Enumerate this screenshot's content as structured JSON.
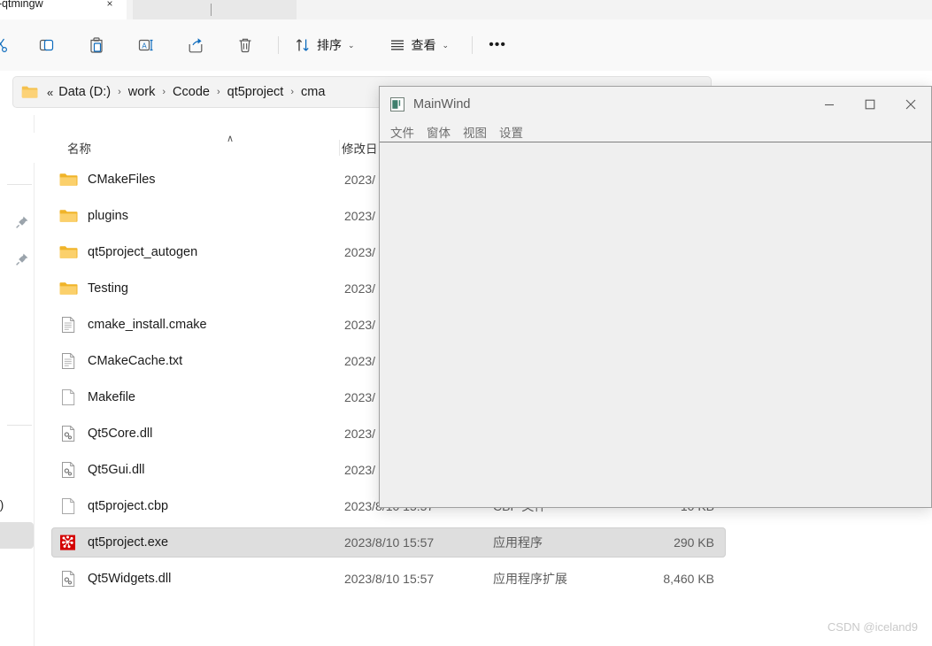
{
  "explorer": {
    "tab": {
      "title": "lease-qtmingw",
      "close_icon": "×",
      "close_icon_name": "close-icon"
    },
    "toolbar": {
      "buttons": [
        {
          "name": "cut-button",
          "icon": "cut-icon",
          "label": ""
        },
        {
          "name": "copy-button",
          "icon": "copy-icon",
          "label": ""
        },
        {
          "name": "paste-button",
          "icon": "paste-icon",
          "label": ""
        },
        {
          "name": "rename-button",
          "icon": "rename-icon",
          "label": ""
        },
        {
          "name": "share-button",
          "icon": "share-icon",
          "label": ""
        },
        {
          "name": "delete-button",
          "icon": "trash-icon",
          "label": ""
        }
      ],
      "sort_label": "排序",
      "view_label": "查看",
      "chevron": "⌄",
      "overflow_label": "•••"
    },
    "address": {
      "overflow_chevrons": "«",
      "separator": "›",
      "crumbs": [
        "Data (D:)",
        "work",
        "Ccode",
        "qt5project",
        "cma"
      ]
    },
    "nav": {
      "drive_label": ":)"
    },
    "columns": {
      "name": "名称",
      "date": "修改日",
      "sort_ascending_mark": "∧"
    },
    "files": [
      {
        "name": "CMakeFiles",
        "icon": "folder-icon",
        "date": "2023/",
        "type": "",
        "size": ""
      },
      {
        "name": "plugins",
        "icon": "folder-icon",
        "date": "2023/",
        "type": "",
        "size": ""
      },
      {
        "name": "qt5project_autogen",
        "icon": "folder-icon",
        "date": "2023/",
        "type": "",
        "size": ""
      },
      {
        "name": "Testing",
        "icon": "folder-icon",
        "date": "2023/",
        "type": "",
        "size": ""
      },
      {
        "name": "cmake_install.cmake",
        "icon": "text-file-icon",
        "date": "2023/",
        "type": "",
        "size": ""
      },
      {
        "name": "CMakeCache.txt",
        "icon": "text-file-icon",
        "date": "2023/",
        "type": "",
        "size": ""
      },
      {
        "name": "Makefile",
        "icon": "blank-file-icon",
        "date": "2023/",
        "type": "",
        "size": ""
      },
      {
        "name": "Qt5Core.dll",
        "icon": "dll-file-icon",
        "date": "2023/",
        "type": "",
        "size": ""
      },
      {
        "name": "Qt5Gui.dll",
        "icon": "dll-file-icon",
        "date": "2023/",
        "type": "",
        "size": ""
      },
      {
        "name": "qt5project.cbp",
        "icon": "blank-file-icon",
        "date": "2023/8/10 15:57",
        "type": "CBP 文件",
        "size": "10 KB"
      },
      {
        "name": "qt5project.exe",
        "icon": "qt-app-icon",
        "date": "2023/8/10 15:57",
        "type": "应用程序",
        "size": "290 KB"
      },
      {
        "name": "Qt5Widgets.dll",
        "icon": "dll-file-icon",
        "date": "2023/8/10 15:57",
        "type": "应用程序扩展",
        "size": "8,460 KB"
      }
    ],
    "selected_index": 10
  },
  "qt_window": {
    "title": "MainWind",
    "minimize_glyph": "—",
    "maximize_glyph": "☐",
    "close_glyph": "✕",
    "menu": [
      {
        "label": "文件"
      },
      {
        "label": "窗体"
      },
      {
        "label": "视图"
      },
      {
        "label": "设置"
      }
    ]
  },
  "watermark": "CSDN @iceland9",
  "colors": {
    "accent": "#0f6cbd",
    "folder": "#fbc44c",
    "selection": "#dedede",
    "qt_chrome": "#f2f2f2",
    "qt_client": "#efefef",
    "exe_icon": "#d40000"
  }
}
